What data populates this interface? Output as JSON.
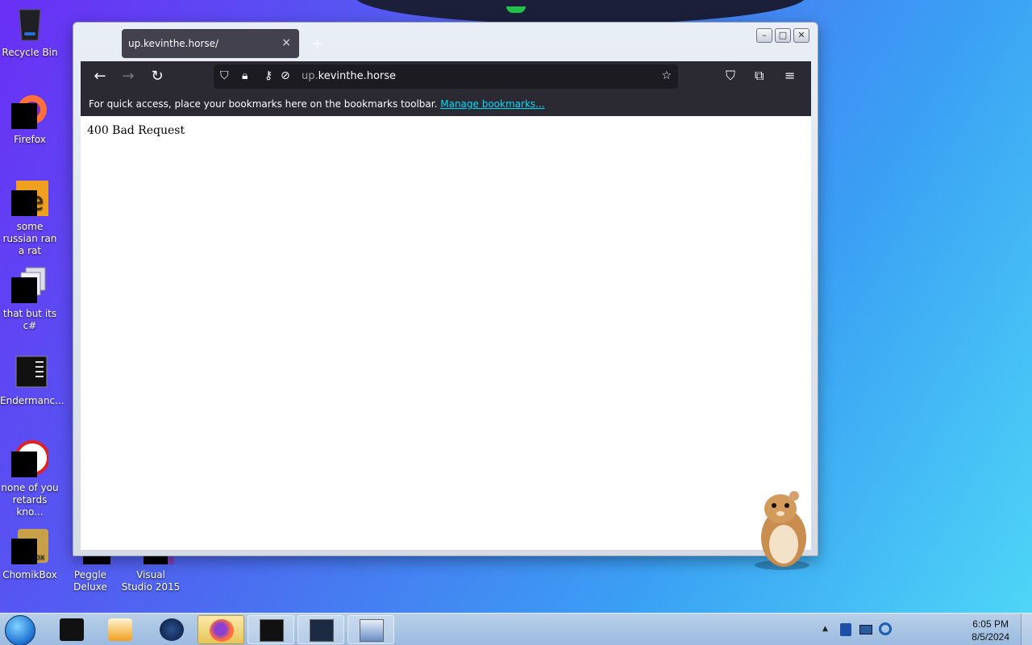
{
  "desktop": {
    "icons": [
      {
        "label": "Recycle Bin"
      },
      {
        "label": "Firefox"
      },
      {
        "label": "some russian ran a rat"
      },
      {
        "label": "that but its c#"
      },
      {
        "label": "Endermanc..."
      },
      {
        "label": "none of you retards kno..."
      },
      {
        "label": "ChomikBox"
      },
      {
        "label": "Peggle Deluxe"
      },
      {
        "label": "Visual Studio 2015"
      }
    ]
  },
  "browser": {
    "tab_title": "up.kevinthe.horse/",
    "tab_close": "×",
    "new_tab": "+",
    "url_subdomain": "up.",
    "url_domain": "kevinthe.horse",
    "bookmarks_text": "For quick access, place your bookmarks here on the bookmarks toolbar.",
    "bookmarks_link": "Manage bookmarks...",
    "page_text": "400 Bad Request"
  },
  "taskbar": {
    "time": "6:05 PM",
    "date": "8/5/2024"
  }
}
